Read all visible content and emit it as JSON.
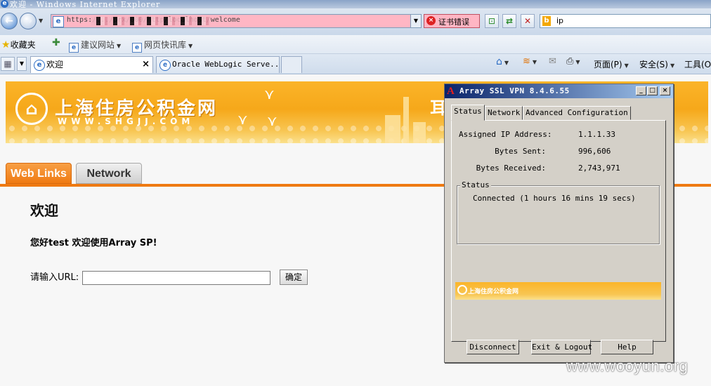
{
  "browser": {
    "window_title": "欢迎 - Windows Internet Explorer",
    "address_url": "https:/.../prx/000/http/localhost/welcome",
    "cert_error": "证书错误",
    "search_value": "ip",
    "favorites_label": "收藏夹",
    "favorites_links": [
      "建议网站",
      "网页快讯库"
    ],
    "tabs": [
      {
        "label": "欢迎"
      },
      {
        "label": "Oracle WebLogic Serve..."
      }
    ],
    "commands": {
      "page": "页面(P)",
      "safety": "安全(S)",
      "tools": "工具(O)"
    },
    "icons": {
      "back": "arrow-left",
      "forward": "arrow-right",
      "refresh": "refresh",
      "stop": "stop-x",
      "home": "house",
      "rss": "feed",
      "mail": "envelope",
      "print": "printer"
    }
  },
  "site": {
    "logo_cn": "上海住房公积金网",
    "logo_en": "WWW.SHGJJ.COM",
    "banner_partial": "耳",
    "nav_tabs": [
      {
        "label": "Web Links",
        "active": true
      },
      {
        "label": "Network",
        "active": false
      }
    ],
    "heading": "欢迎",
    "greeting": "您好test 欢迎使用Array SP!",
    "url_label": "请输入URL:",
    "url_value": "",
    "submit_label": "确定",
    "accent_color": "#ef7a12"
  },
  "vpn": {
    "title": "Array SSL VPN 8.4.6.55",
    "tabs": [
      "Status",
      "Network",
      "Advanced Configuration"
    ],
    "active_tab": "Status",
    "fields": [
      {
        "label": "Assigned IP Address:",
        "value": "1.1.1.33"
      },
      {
        "label": "Bytes Sent:",
        "value": "996,606"
      },
      {
        "label": "Bytes Received:",
        "value": "2,743,971"
      }
    ],
    "status_group_label": "Status",
    "status_text": "Connected (1 hours 16 mins 19 secs)",
    "buttons": {
      "disconnect": "Disconnect",
      "exit": "Exit & Logout",
      "help": "Help"
    }
  },
  "watermark": "www.wooyun.org"
}
